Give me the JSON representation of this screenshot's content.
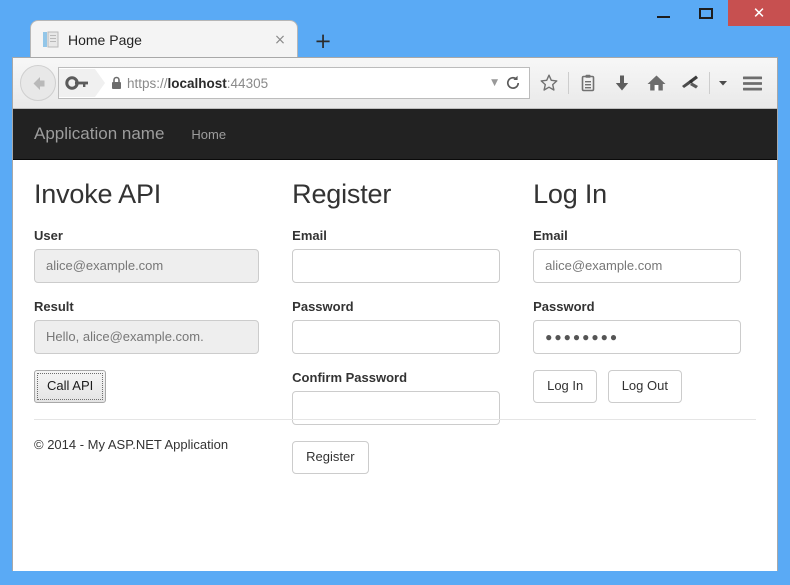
{
  "window": {
    "minimize_label": "—",
    "maximize_label": "□",
    "close_label": "✕"
  },
  "tabs": [
    {
      "title": "Home Page",
      "close_label": "×",
      "favicon": "page-icon"
    }
  ],
  "new_tab_label": "+",
  "toolbar": {
    "back_icon": "back-arrow-icon",
    "identity_icon": "key-icon",
    "lock_icon": "lock-icon",
    "url_scheme": "https://",
    "url_host": "localhost",
    "url_port": ":44305",
    "url_full": "https://localhost:44305",
    "dropdown_caret": "▼",
    "reload_icon": "reload-icon",
    "icons": [
      {
        "name": "bookmark-star-icon"
      },
      {
        "name": "reading-list-icon"
      },
      {
        "name": "downloads-icon"
      },
      {
        "name": "home-icon"
      },
      {
        "name": "pocket-icon"
      }
    ],
    "overflow_caret": "▾",
    "menu_icon": "hamburger-menu-icon"
  },
  "site_nav": {
    "brand": "Application name",
    "links": [
      {
        "label": "Home"
      }
    ]
  },
  "columns": {
    "invoke_api": {
      "title": "Invoke API",
      "user_label": "User",
      "user_value": "alice@example.com",
      "result_label": "Result",
      "result_value": "Hello, alice@example.com.",
      "call_button": "Call API"
    },
    "register": {
      "title": "Register",
      "email_label": "Email",
      "email_value": "",
      "password_label": "Password",
      "password_value": "",
      "confirm_label": "Confirm Password",
      "confirm_value": "",
      "register_button": "Register"
    },
    "login": {
      "title": "Log In",
      "email_label": "Email",
      "email_value": "alice@example.com",
      "password_label": "Password",
      "password_value": "●●●●●●●●",
      "login_button": "Log In",
      "logout_button": "Log Out"
    }
  },
  "footer": {
    "copyright": "© 2014 - My ASP.NET Application"
  },
  "colors": {
    "desktop_blue": "#5aaaf5",
    "navbar_dark": "#222222",
    "close_red": "#c75050",
    "readonly_gray": "#eeeeee",
    "border_gray": "#cccccc"
  }
}
